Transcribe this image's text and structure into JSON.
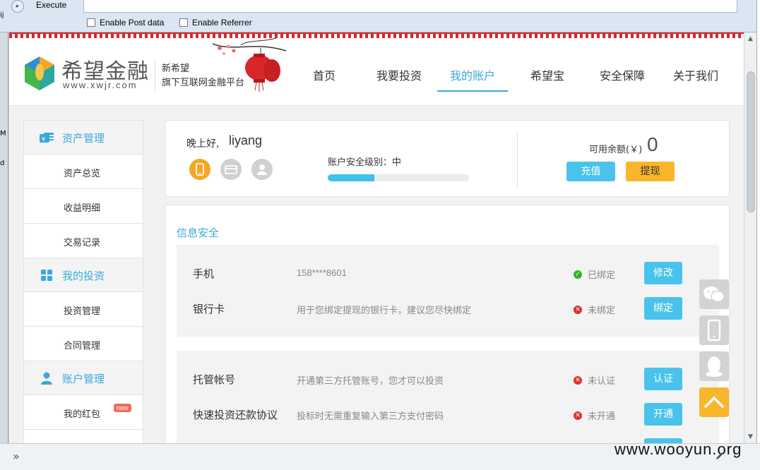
{
  "hackbar": {
    "execute_label": "Execute",
    "enable_post_label": "Enable Post data",
    "enable_referrer_label": "Enable Referrer"
  },
  "left_strip": {
    "marks": [
      "ij",
      "M",
      "d"
    ]
  },
  "header": {
    "brand_name": "希望金融",
    "brand_url": "www.xwjr.com",
    "slogan_line1": "新希望",
    "slogan_line2": "旗下互联网金融平台",
    "nav": [
      {
        "label": "首页",
        "active": false
      },
      {
        "label": "我要投资",
        "active": false
      },
      {
        "label": "我的账户",
        "active": true
      },
      {
        "label": "希望宝",
        "active": false
      },
      {
        "label": "安全保障",
        "active": false
      },
      {
        "label": "关于我们",
        "active": false
      }
    ]
  },
  "sidebar": {
    "groups": [
      {
        "title": "资产管理",
        "icon": "wallet-icon",
        "items": [
          "资产总览",
          "收益明细",
          "交易记录"
        ]
      },
      {
        "title": "我的投资",
        "icon": "grid-icon",
        "items": [
          "投资管理",
          "合同管理"
        ]
      },
      {
        "title": "账户管理",
        "icon": "user-icon",
        "items": [
          "我的红包"
        ]
      }
    ],
    "new_badge": "new"
  },
  "user_card": {
    "greeting": "晚上好,",
    "username": "liyang",
    "security_label": "账户安全级别：中",
    "security_level": 0.33,
    "balance_label": "可用余额(￥)",
    "balance_value": "0",
    "recharge_label": "充值",
    "withdraw_label": "提现"
  },
  "info": {
    "title": "信息安全",
    "rows": [
      {
        "label": "手机",
        "desc": "158****8601",
        "status": "已绑定",
        "ok": true,
        "action": "修改"
      },
      {
        "label": "银行卡",
        "desc": "用于您绑定提现的银行卡，建议您尽快绑定",
        "status": "未绑定",
        "ok": false,
        "action": "绑定"
      },
      {
        "label": "托管帐号",
        "desc": "开通第三方托管账号，您才可以投资",
        "status": "未认证",
        "ok": false,
        "action": "认证"
      },
      {
        "label": "快速投资还款协议",
        "desc": "投标时无需重复输入第三方支付密码",
        "status": "未开通",
        "ok": false,
        "action": "开通"
      }
    ]
  },
  "watermark": "www.wooyun.org",
  "colors": {
    "accent": "#3aa9d8",
    "button_blue": "#49c3ec",
    "button_yellow": "#fbb52b",
    "ok_green": "#2eb52e",
    "error_red": "#e0312a"
  }
}
